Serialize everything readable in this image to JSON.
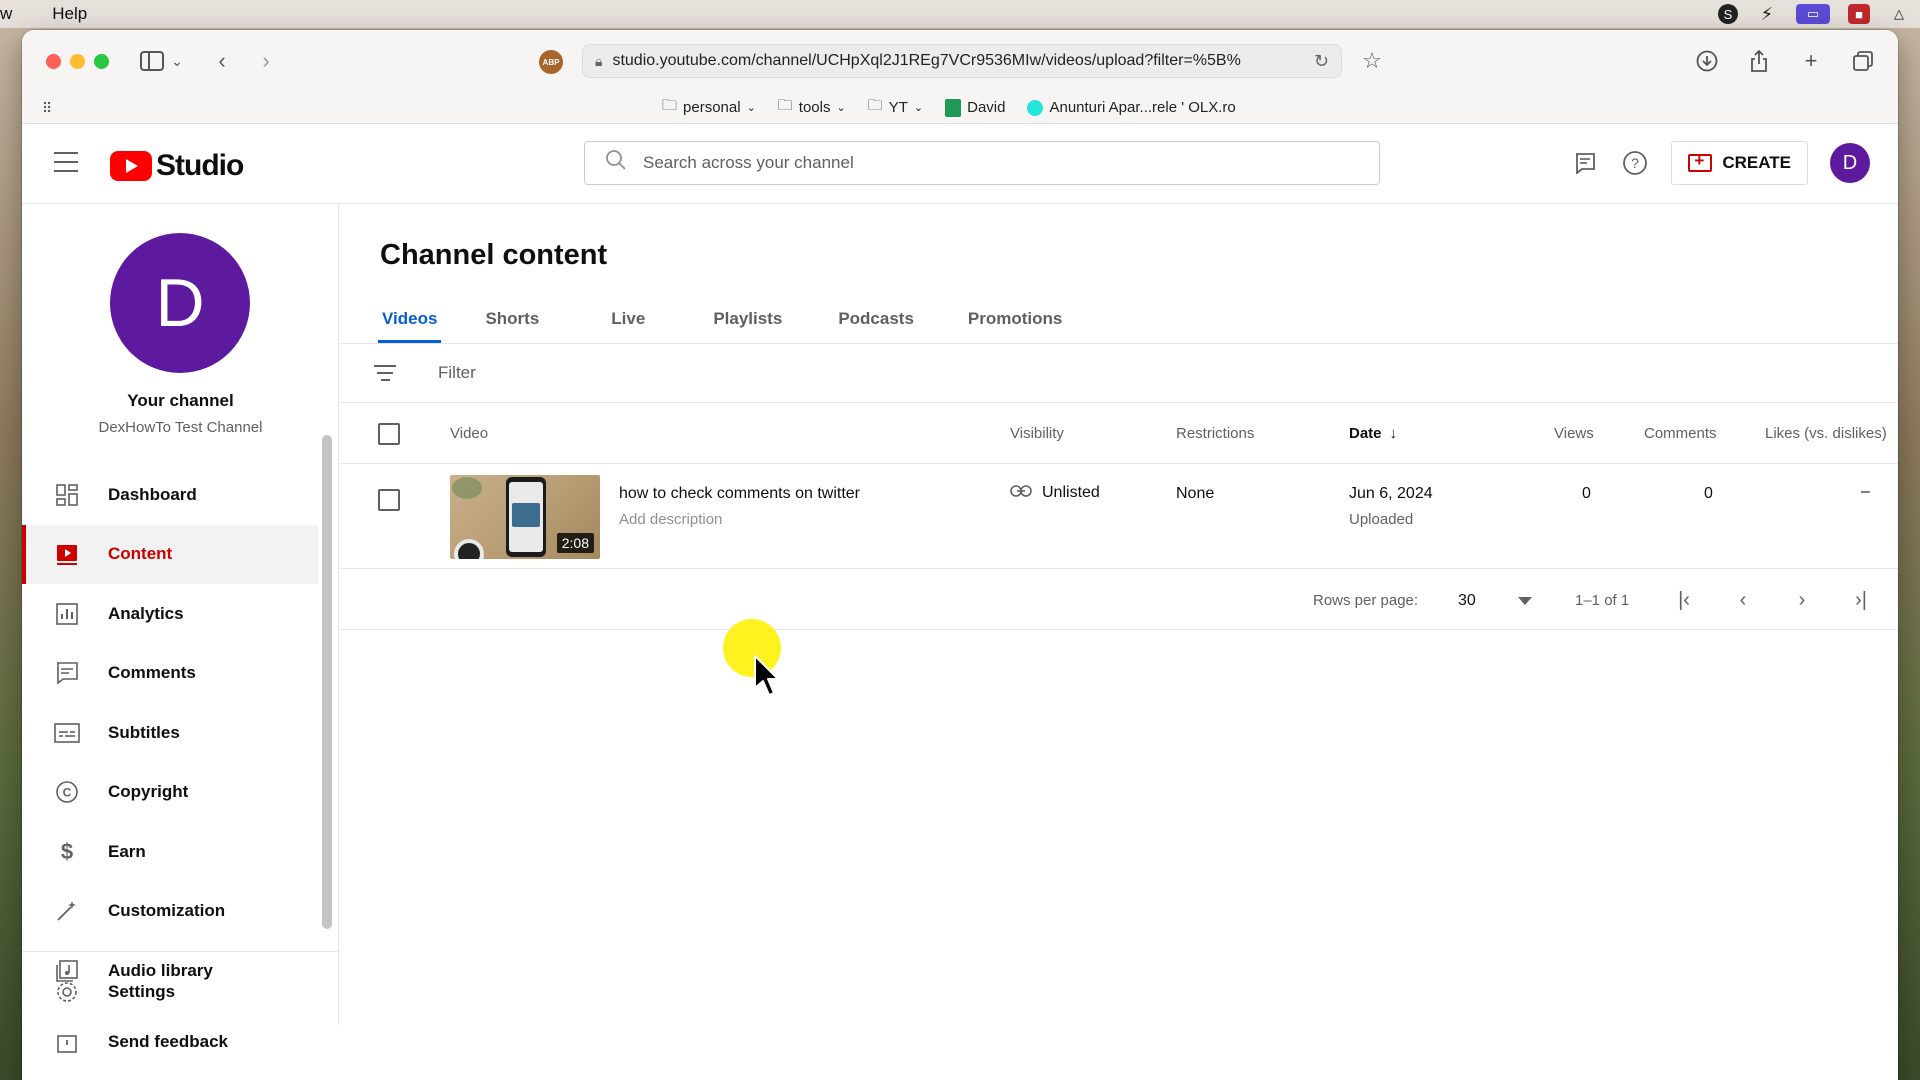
{
  "menubar": {
    "left_items": [
      "w",
      "Help"
    ]
  },
  "browser": {
    "url": "studio.youtube.com/channel/UCHpXql2J1REg7VCr9536MIw/videos/upload?filter=%5B%",
    "bookmarks": [
      "personal",
      "tools",
      "YT",
      "David",
      "Anunturi Apar...rele ' OLX.ro"
    ]
  },
  "header": {
    "logo_text": "Studio",
    "search_placeholder": "Search across your channel",
    "create_label": "CREATE",
    "avatar_letter": "D"
  },
  "sidebar": {
    "avatar_letter": "D",
    "channel_title": "Your channel",
    "channel_name": "DexHowTo Test Channel",
    "items": [
      {
        "label": "Dashboard",
        "icon": "dashboard-icon",
        "active": false
      },
      {
        "label": "Content",
        "icon": "content-icon",
        "active": true
      },
      {
        "label": "Analytics",
        "icon": "analytics-icon",
        "active": false
      },
      {
        "label": "Comments",
        "icon": "comments-icon",
        "active": false
      },
      {
        "label": "Subtitles",
        "icon": "subtitles-icon",
        "active": false
      },
      {
        "label": "Copyright",
        "icon": "copyright-icon",
        "active": false
      },
      {
        "label": "Earn",
        "icon": "earn-icon",
        "active": false
      },
      {
        "label": "Customization",
        "icon": "customization-icon",
        "active": false
      },
      {
        "label": "Audio library",
        "icon": "audio-library-icon",
        "active": false
      }
    ],
    "settings_label": "Settings",
    "feedback_label": "Send feedback"
  },
  "main": {
    "title": "Channel content",
    "tabs": [
      "Videos",
      "Shorts",
      "Live",
      "Playlists",
      "Podcasts",
      "Promotions"
    ],
    "active_tab": "Videos",
    "filter_label": "Filter",
    "columns": {
      "video": "Video",
      "visibility": "Visibility",
      "restrictions": "Restrictions",
      "date": "Date",
      "views": "Views",
      "comments": "Comments",
      "likes": "Likes (vs. dislikes)"
    },
    "rows": [
      {
        "title": "how to check comments on twitter",
        "description": "Add description",
        "duration": "2:08",
        "visibility": "Unlisted",
        "restrictions": "None",
        "date": "Jun 6, 2024",
        "date_status": "Uploaded",
        "views": "0",
        "comments": "0",
        "likes": "–"
      }
    ],
    "pagination": {
      "rows_per_page_label": "Rows per page:",
      "rows_per_page": "30",
      "range": "1–1 of 1"
    }
  },
  "colors": {
    "accent_blue": "#065fd4",
    "youtube_red": "#ff0000",
    "active_nav_red": "#cc0000",
    "avatar_purple": "#5d1a9e"
  }
}
